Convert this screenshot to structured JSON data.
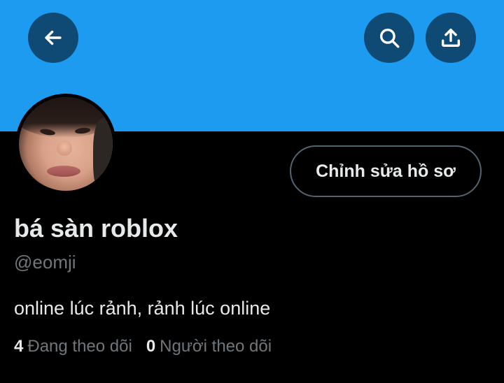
{
  "header": {
    "banner_color": "#1d9bf0",
    "buttons": [
      {
        "name": "back",
        "icon": "arrow-left-icon"
      },
      {
        "name": "search",
        "icon": "search-icon"
      },
      {
        "name": "share",
        "icon": "share-icon"
      }
    ]
  },
  "profile": {
    "avatar": "profile-photo",
    "edit_button_label": "Chỉnh sửa hồ sơ",
    "display_name": "bá sàn roblox",
    "handle": "@eomji",
    "bio": "online lúc rảnh, rảnh lúc online",
    "following_count": "4",
    "following_label": "Đang theo dõi",
    "followers_count": "0",
    "followers_label": "Người theo dõi"
  }
}
